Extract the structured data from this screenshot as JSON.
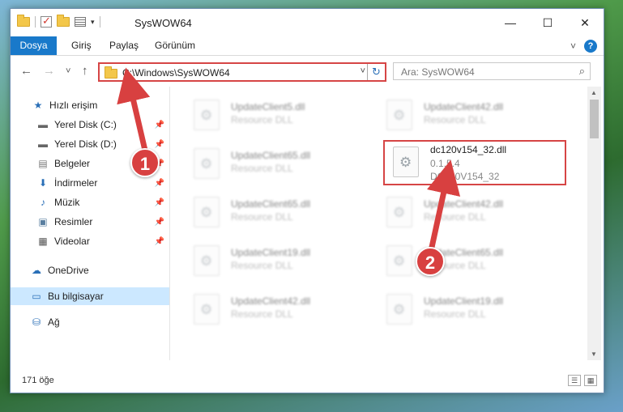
{
  "window": {
    "title": "SysWOW64",
    "controls": {
      "minimize": "—",
      "maximize": "☐",
      "close": "✕"
    }
  },
  "ribbon": {
    "tabs": [
      {
        "label": "Dosya"
      },
      {
        "label": "Giriş"
      },
      {
        "label": "Paylaş"
      },
      {
        "label": "Görünüm"
      }
    ],
    "expand_icon": "˅",
    "help": "?"
  },
  "nav": {
    "back": "←",
    "forward": "→",
    "recent": "˅",
    "up": "↑",
    "address": "C:\\Windows\\SysWOW64",
    "address_dropdown": "˅",
    "refresh": "↻",
    "search_placeholder": "Ara: SysWOW64",
    "search_icon": "⌕"
  },
  "sidebar": {
    "items": [
      {
        "label": "Hızlı erişim",
        "icon": "★",
        "pinned": false
      },
      {
        "label": "Yerel Disk (C:)",
        "icon": "▬",
        "pinned": true
      },
      {
        "label": "Yerel Disk (D:)",
        "icon": "▬",
        "pinned": true
      },
      {
        "label": "Belgeler",
        "icon": "▤",
        "pinned": true
      },
      {
        "label": "İndirmeler",
        "icon": "⬇",
        "pinned": true
      },
      {
        "label": "Müzik",
        "icon": "♪",
        "pinned": true
      },
      {
        "label": "Resimler",
        "icon": "▣",
        "pinned": true
      },
      {
        "label": "Videolar",
        "icon": "▦",
        "pinned": true
      },
      {
        "label": "OneDrive",
        "icon": "☁",
        "pinned": false
      },
      {
        "label": "Bu bilgisayar",
        "icon": "▭",
        "pinned": false,
        "selected": true
      },
      {
        "label": "Ağ",
        "icon": "⛁",
        "pinned": false
      }
    ],
    "pin_glyph": "📌"
  },
  "files": {
    "left_column": [
      {
        "name": "UpdateClient5.dll",
        "desc": "Resource DLL"
      },
      {
        "name": "UpdateClient65.dll",
        "desc": "Resource DLL"
      },
      {
        "name": "UpdateClient65.dll",
        "desc": "Resource DLL"
      },
      {
        "name": "UpdateClient19.dll",
        "desc": "Resource DLL"
      },
      {
        "name": "UpdateClient42.dll",
        "desc": "Resource DLL"
      }
    ],
    "right_column": [
      {
        "name": "UpdateClient42.dll",
        "desc": "Resource DLL"
      },
      {
        "name": "UpdateClient42.dll",
        "desc": "Resource DLL"
      },
      {
        "name": "UpdateClient65.dll",
        "desc": "Resource DLL"
      },
      {
        "name": "UpdateClient19.dll",
        "desc": "Resource DLL"
      }
    ],
    "highlighted": {
      "name": "dc120v154_32.dll",
      "version": "0.1.5.4",
      "desc": "DC120V154_32"
    }
  },
  "status": {
    "count": "171 öğe"
  },
  "annotations": {
    "badge1": "1",
    "badge2": "2",
    "color": "#d84040"
  }
}
